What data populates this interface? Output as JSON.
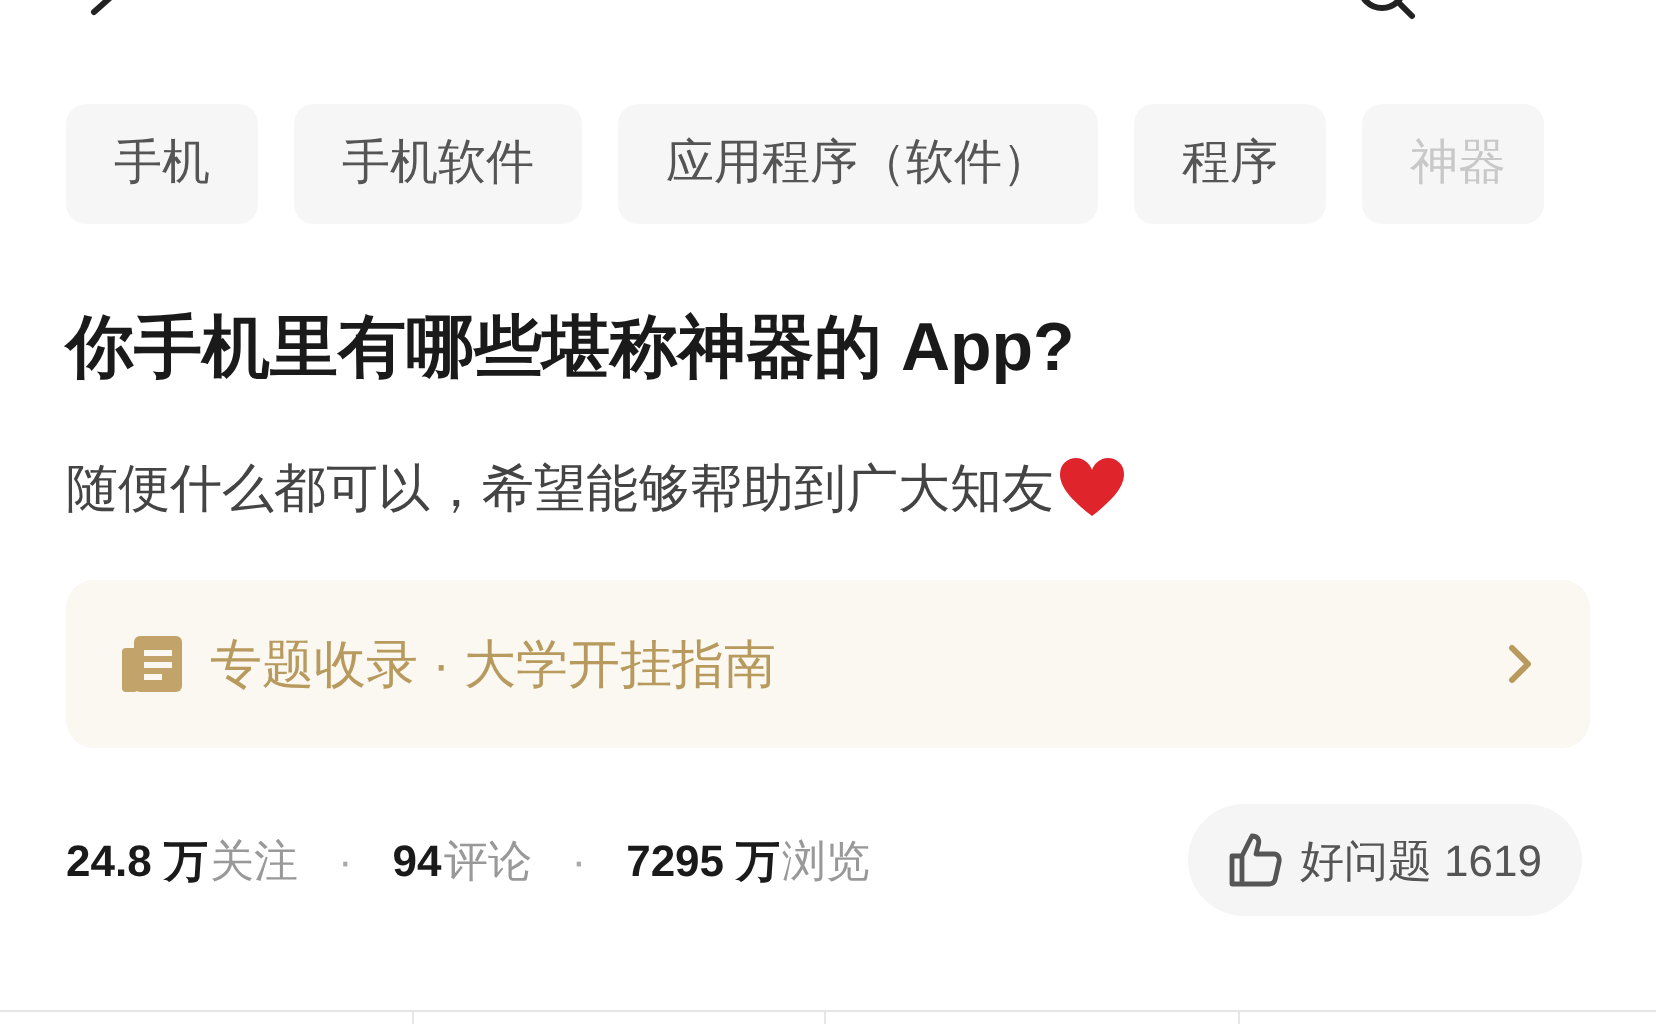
{
  "tags": [
    {
      "label": "手机"
    },
    {
      "label": "手机软件"
    },
    {
      "label": "应用程序（软件）"
    },
    {
      "label": "程序"
    },
    {
      "label": "神器"
    }
  ],
  "question": {
    "title": "你手机里有哪些堪称神器的 App?",
    "description": "随便什么都可以，希望能够帮助到广大知友"
  },
  "collection_banner": {
    "label": "专题收录 · 大学开挂指南"
  },
  "stats": [
    {
      "value": "24.8 万",
      "label": "关注"
    },
    {
      "value": "94",
      "label": "评论"
    },
    {
      "value": "7295 万",
      "label": "浏览"
    }
  ],
  "separators": [
    "·",
    "·"
  ],
  "good_question_button": {
    "label": "好问题 1619"
  }
}
